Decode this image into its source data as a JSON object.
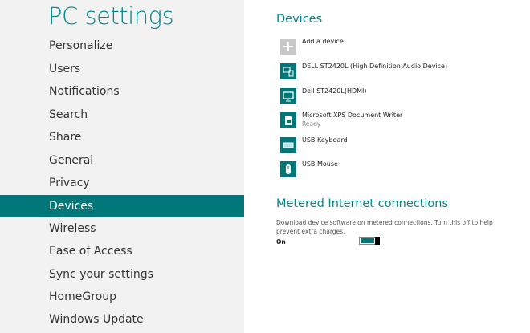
{
  "title": "PC settings",
  "nav": [
    "Personalize",
    "Users",
    "Notifications",
    "Search",
    "Share",
    "General",
    "Privacy",
    "Devices",
    "Wireless",
    "Ease of Access",
    "Sync your settings",
    "HomeGroup",
    "Windows Update"
  ],
  "selected": "Devices",
  "devices_heading": "Devices",
  "devices": [
    {
      "name": "Add a device",
      "icon": "plus-icon"
    },
    {
      "name": "DELL ST2420L (High Definition Audio Device)",
      "icon": "audio-device-icon"
    },
    {
      "name": "Dell ST2420L(HDMI)",
      "icon": "monitor-icon"
    },
    {
      "name": "Microsoft XPS Document Writer",
      "status": "Ready",
      "icon": "printer-icon"
    },
    {
      "name": "USB Keyboard",
      "icon": "keyboard-icon"
    },
    {
      "name": "USB Mouse",
      "icon": "mouse-icon"
    }
  ],
  "metered": {
    "heading": "Metered Internet connections",
    "description": "Download device software on metered connections. Turn this off to help prevent extra charges.",
    "state": "On",
    "enabled": true
  },
  "colors": {
    "accent": "#00787a",
    "heading": "#008a8c"
  }
}
